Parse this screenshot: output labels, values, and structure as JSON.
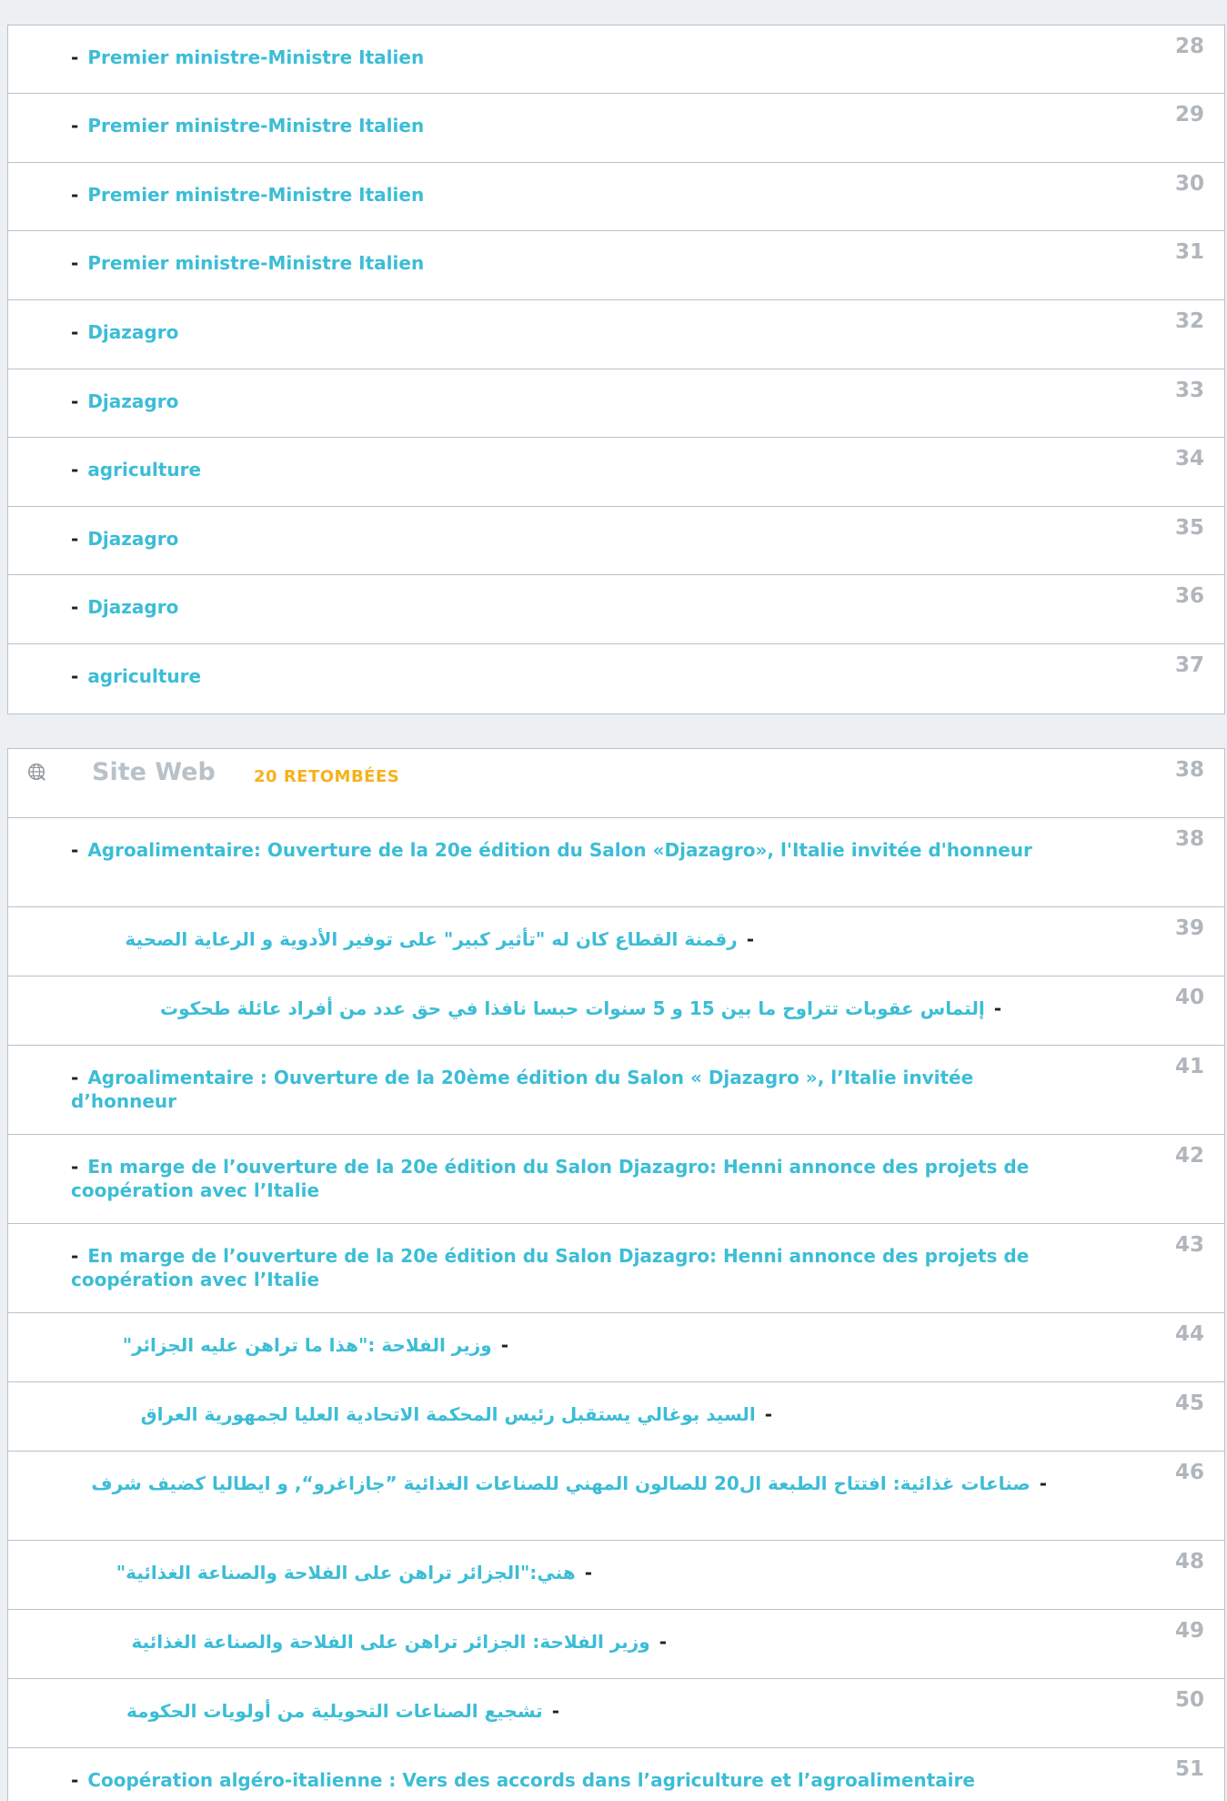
{
  "list_top": {
    "items": [
      {
        "title": "Premier ministre-Ministre Italien",
        "num": "28"
      },
      {
        "title": "Premier ministre-Ministre Italien",
        "num": "29"
      },
      {
        "title": "Premier ministre-Ministre Italien",
        "num": "30"
      },
      {
        "title": "Premier ministre-Ministre Italien",
        "num": "31"
      },
      {
        "title": "Djazagro",
        "num": "32"
      },
      {
        "title": "Djazagro",
        "num": "33"
      },
      {
        "title": "agriculture",
        "num": "34"
      },
      {
        "title": "Djazagro",
        "num": "35"
      },
      {
        "title": "Djazagro",
        "num": "36"
      },
      {
        "title": "agriculture",
        "num": "37"
      }
    ]
  },
  "site_web": {
    "icon": "globe-icon",
    "title": "Site Web",
    "count_label": "20 RETOMBÉES",
    "num": "38",
    "items": [
      {
        "title": "Agroalimentaire: Ouverture de la 20e édition du Salon «Djazagro», l'Italie invitée d'honneur",
        "num": "38"
      },
      {
        "title": "رقمنة القطاع كان له \"تأثير كبير\" على توفير الأدوية و الرعاية الصحية",
        "num": "39"
      },
      {
        "title": "إلتماس عقوبات تتراوح ما بين 15 و 5 سنوات حبسا نافذا في حق عدد من أفراد عائلة طحكوت",
        "num": "40"
      },
      {
        "title": "Agroalimentaire : Ouverture de la 20ème édition du Salon « Djazagro », l’Italie invitée d’honneur",
        "num": "41"
      },
      {
        "title": "En marge de l’ouverture de la 20e édition du Salon Djazagro: Henni annonce des projets de coopération avec l’Italie",
        "num": "42"
      },
      {
        "title": "En marge de l’ouverture de la 20e édition du Salon Djazagro: Henni annonce des projets de coopération avec l’Italie",
        "num": "43"
      },
      {
        "title": "وزير الفلاحة :\"هذا ما تراهن عليه الجزائر\"",
        "num": "44"
      },
      {
        "title": "السيد بوغالي يستقبل رئيس المحكمة الاتحادية العليا لجمهورية العراق",
        "num": "45"
      },
      {
        "title": "صناعات غذائية: افتتاح الطبعة ال20 للصالون المهني للصناعات الغذائية ”جازاغرو“, و ايطاليا كضيف شرف",
        "num": "46"
      },
      {
        "title": "هني:\"الجزائر تراهن على الفلاحة والصناعة الغذائية\"",
        "num": "48"
      },
      {
        "title": "وزير الفلاحة: الجزائر تراهن على الفلاحة والصناعة الغذائية",
        "num": "49"
      },
      {
        "title": "تشجيع الصناعات التحويلية من أولويات الحكومة",
        "num": "50"
      },
      {
        "title": "Coopération algéro-italienne : Vers des accords dans l’agriculture et l’agroalimentaire",
        "num": "51"
      }
    ]
  },
  "colors": {
    "link": "#3cbdd6",
    "count_accent": "#f6b21b",
    "number": "#b0b6bc",
    "border": "#b9c1c8",
    "page_bg": "#ecf0f3"
  }
}
